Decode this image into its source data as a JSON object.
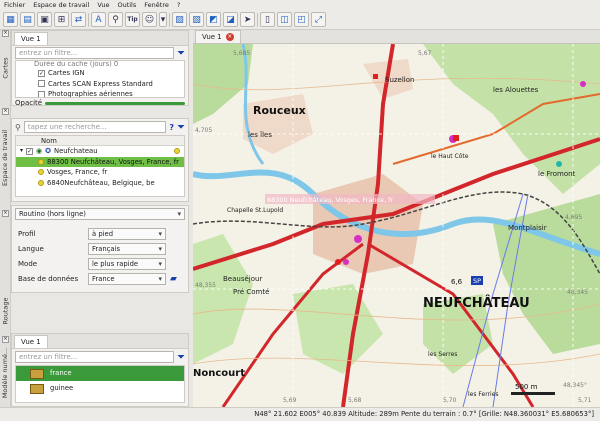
{
  "menu": [
    "Fichier",
    "Espace de travail",
    "Vue",
    "Outils",
    "Fenêtre",
    "?"
  ],
  "side_tabs": [
    "Cartes",
    "Espace de travail",
    "Routage",
    "Modèle numé..."
  ],
  "maps_panel": {
    "filter_placeholder": "entrez un filtre...",
    "items": [
      {
        "label": "Durée du cache (jours) 0",
        "checked": false
      },
      {
        "label": "Cartes IGN",
        "checked": true
      },
      {
        "label": "Cartes SCAN Express Standard",
        "checked": false
      },
      {
        "label": "Photographies aériennes",
        "checked": false
      }
    ],
    "opacity_label": "Opacité"
  },
  "workspace_panel": {
    "search_placeholder": "tapez une recherche...",
    "help": "?",
    "column_header": "Nom",
    "root_label": "Neufchateau",
    "results": [
      "88300 Neufchâteau, Vosges, France, fr",
      "Vosges, France, fr",
      "6840Neufchâteau, Belgique, be"
    ]
  },
  "routing_panel": {
    "engine": "Routino (hors ligne)",
    "fields": [
      {
        "label": "Profil",
        "value": "à pied"
      },
      {
        "label": "Langue",
        "value": "Français"
      },
      {
        "label": "Mode",
        "value": "le plus rapide"
      },
      {
        "label": "Base de données",
        "value": "France"
      }
    ]
  },
  "dem_panel": {
    "tab": "Vue 1",
    "filter_placeholder": "entrez un filtre...",
    "items": [
      {
        "label": "france",
        "selected": true
      },
      {
        "label": "guinee",
        "selected": false
      }
    ]
  },
  "map_view": {
    "tab": "Vue 1",
    "labels": {
      "rouceux": "Rouceux",
      "neufchateau": "NEUFCHÂTEAU",
      "noncourt": "Noncourt",
      "suzellon": "Suzellon",
      "alouettes": "les Alouettes",
      "fromont": "le Fromont",
      "montplaisir": "Montplaisir",
      "beausejour": "Beauséjour",
      "pre_comte": "Pré Comté",
      "chapelle": "Chapelle St.Lupold",
      "les_iles": "les îles",
      "haut_cote": "le Haut Côte",
      "serres": "les Serres",
      "ferries": "les Ferries",
      "sp": "SP",
      "num_66": "6,6",
      "overlay_label": "88300 Neufchâteau, Vosges, France, fr"
    },
    "grid": [
      "5,685",
      "5,67",
      "4,705",
      "4,695",
      "48,355",
      "48,345",
      "48,345°",
      "5,69",
      "5,68",
      "5,70",
      "5,71"
    ],
    "scale": "500 m"
  },
  "status_bar": "N48° 21.602 E005° 40.839  Altitude: 289m  Pente du terrain : 0.7°  [Grille: N48.360031° E5.680653°]",
  "colors": {
    "accent_green": "#6fbf46",
    "dark_green": "#3a9a3a",
    "road_red": "#d2262b",
    "river_blue": "#7ec7e8",
    "map_bg": "#f4f1e6",
    "forest": "#b9dc9c"
  }
}
